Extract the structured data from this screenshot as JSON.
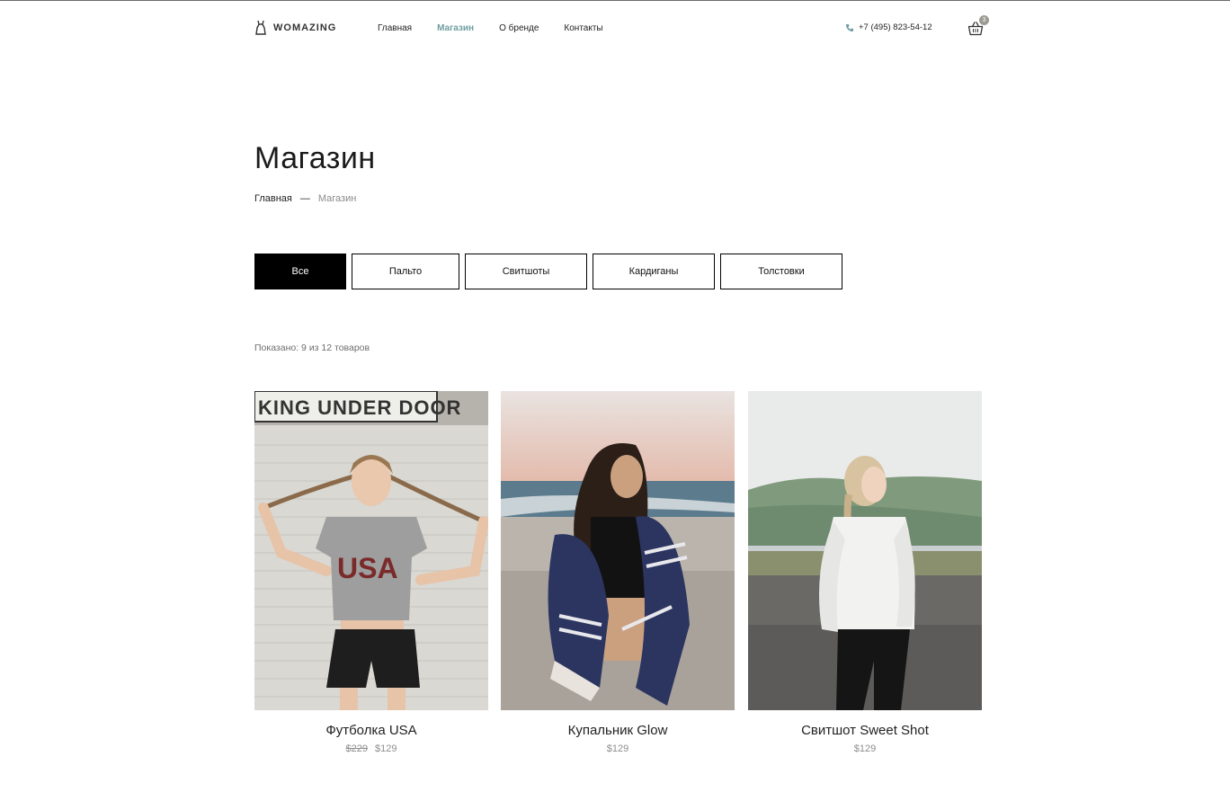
{
  "header": {
    "logo_text": "WOMAZING",
    "nav": [
      "Главная",
      "Магазин",
      "О бренде",
      "Контакты"
    ],
    "active_nav": "Магазин",
    "phone": "+7 (495) 823-54-12",
    "cart_count": "3",
    "accent_color": "#6e9c9f"
  },
  "page": {
    "title": "Магазин",
    "breadcrumb": {
      "home": "Главная",
      "separator": "—",
      "current": "Магазин"
    }
  },
  "filters": [
    "Все",
    "Пальто",
    "Свитшоты",
    "Кардиганы",
    "Толстовки"
  ],
  "active_filter": "Все",
  "shown_text": "Показано: 9 из 12 товаров",
  "products": [
    {
      "name": "Футболка USA",
      "old_price": "$229",
      "price": "$129",
      "image": "woman-usa-tshirt",
      "sign_text": "KING UNDER DOOR",
      "shirt_text": "USA"
    },
    {
      "name": "Купальник Glow",
      "old_price": "",
      "price": "$129",
      "image": "woman-beach-towel"
    },
    {
      "name": "Свитшот Sweet Shot",
      "old_price": "",
      "price": "$129",
      "image": "woman-white-sweater"
    }
  ]
}
